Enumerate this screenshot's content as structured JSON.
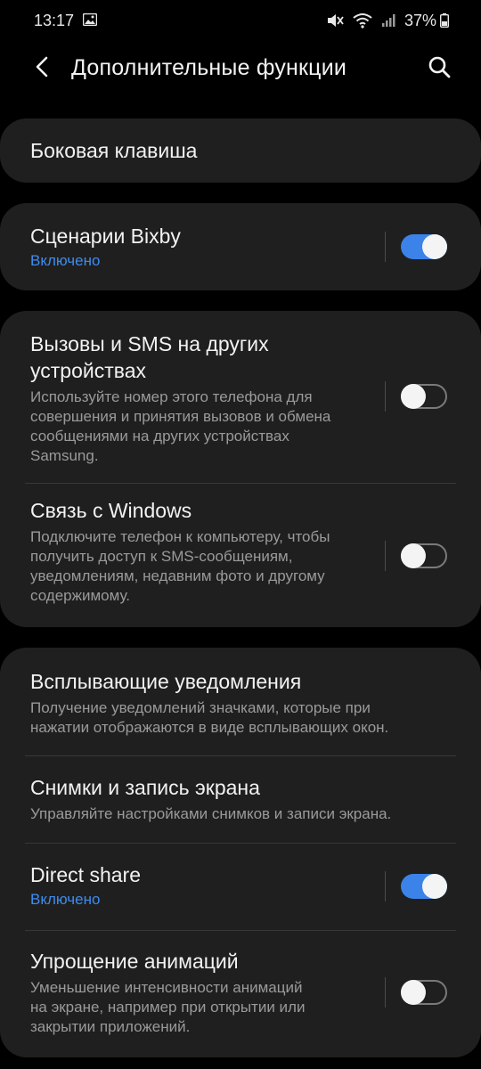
{
  "status_bar": {
    "time": "13:17",
    "battery": "37%",
    "icons": [
      "gallery-icon",
      "mute-icon",
      "wifi-icon",
      "signal-icon",
      "battery-icon"
    ]
  },
  "header": {
    "title": "Дополнительные функции",
    "back_icon": "chevron-left-icon",
    "search_icon": "search-icon"
  },
  "items": {
    "side_key": {
      "title": "Боковая клавиша"
    },
    "bixby": {
      "title": "Сценарии Bixby",
      "status": "Включено",
      "enabled": true
    },
    "calls_sms": {
      "title_line1": "Вызовы и SMS на других",
      "title_line2": "устройствах",
      "desc_line1": "Используйте номер этого телефона для",
      "desc_line2": "совершения и принятия вызовов и обмена",
      "desc_line3": "сообщениями на других устройствах",
      "desc_line4": "Samsung.",
      "enabled": false
    },
    "windows": {
      "title": "Связь с Windows",
      "desc_line1": "Подключите телефон к компьютеру, чтобы",
      "desc_line2": "получить доступ к SMS-сообщениям,",
      "desc_line3": "уведомлениям, недавним фото и другому",
      "desc_line4": "содержимому.",
      "enabled": false
    },
    "popup": {
      "title": "Всплывающие уведомления",
      "desc_line1": "Получение уведомлений значками, которые при",
      "desc_line2": "нажатии отображаются в виде всплывающих окон."
    },
    "screenshots": {
      "title": "Снимки и запись экрана",
      "desc_line1": "Управляйте настройками снимков и записи экрана."
    },
    "direct_share": {
      "title": "Direct share",
      "status": "Включено",
      "enabled": true
    },
    "animations": {
      "title": "Упрощение анимаций",
      "desc_line1": "Уменьшение интенсивности анимаций",
      "desc_line2": "на экране, например при открытии или",
      "desc_line3": "закрытии приложений.",
      "enabled": false
    }
  },
  "colors": {
    "accent": "#3b83e8",
    "status_text": "#3d8cf0",
    "card": "#1f1f1f",
    "background": "#000000"
  }
}
